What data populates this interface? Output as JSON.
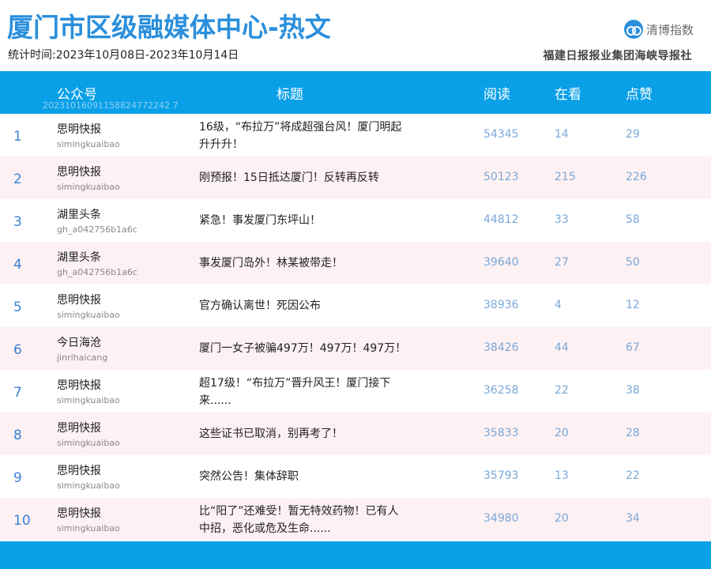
{
  "header": {
    "title": "厦门市区级融媒体中心-热文",
    "period": "统计时间:2023年10月08日-2023年10月14日",
    "brand_name": "清博指数",
    "publisher": "福建日报报业集团海峡导报社"
  },
  "table": {
    "columns": {
      "account": "公众号",
      "title": "标题",
      "reads": "阅读",
      "watching": "在看",
      "likes": "点赞"
    },
    "header_id": "20231016091158824772242 7",
    "rows": [
      {
        "rank": "1",
        "account": "思明快报",
        "account_id": "simingkuaibao",
        "title_line1": "16级，“布拉万”将成超强台风！厦门明起",
        "title_line2": "升升升！",
        "reads": "54345",
        "watching": "14",
        "likes": "29"
      },
      {
        "rank": "2",
        "account": "思明快报",
        "account_id": "simingkuaibao",
        "title_line1": "刚预报！15日抵达厦门！反转再反转",
        "title_line2": "",
        "reads": "50123",
        "watching": "215",
        "likes": "226"
      },
      {
        "rank": "3",
        "account": "湖里头条",
        "account_id": "gh_a042756b1a6c",
        "title_line1": "紧急！事发厦门东坪山！",
        "title_line2": "",
        "reads": "44812",
        "watching": "33",
        "likes": "58"
      },
      {
        "rank": "4",
        "account": "湖里头条",
        "account_id": "gh_a042756b1a6c",
        "title_line1": "事发厦门岛外！林某被带走！",
        "title_line2": "",
        "reads": "39640",
        "watching": "27",
        "likes": "50"
      },
      {
        "rank": "5",
        "account": "思明快报",
        "account_id": "simingkuaibao",
        "title_line1": "官方确认离世！死因公布",
        "title_line2": "",
        "reads": "38936",
        "watching": "4",
        "likes": "12"
      },
      {
        "rank": "6",
        "account": "今日海沧",
        "account_id": "jinrihaicang",
        "title_line1": "厦门一女子被骗497万！497万！497万！",
        "title_line2": "",
        "reads": "38426",
        "watching": "44",
        "likes": "67"
      },
      {
        "rank": "7",
        "account": "思明快报",
        "account_id": "simingkuaibao",
        "title_line1": "超17级！“布拉万”晋升风王！厦门接下",
        "title_line2": "来......",
        "reads": "36258",
        "watching": "22",
        "likes": "38"
      },
      {
        "rank": "8",
        "account": "思明快报",
        "account_id": "simingkuaibao",
        "title_line1": "这些证书已取消，别再考了！",
        "title_line2": "",
        "reads": "35833",
        "watching": "20",
        "likes": "28"
      },
      {
        "rank": "9",
        "account": "思明快报",
        "account_id": "simingkuaibao",
        "title_line1": "突然公告！集体辞职",
        "title_line2": "",
        "reads": "35793",
        "watching": "13",
        "likes": "22"
      },
      {
        "rank": "10",
        "account": "思明快报",
        "account_id": "simingkuaibao",
        "title_line1": "比“阳了”还难受！暂无特效药物！已有人",
        "title_line2": "中招，恶化或危及生命......",
        "reads": "34980",
        "watching": "20",
        "likes": "34"
      }
    ]
  },
  "colors": {
    "accent": "#0aa0e8",
    "title": "#2b8fdc",
    "row_alt": "#fdf1f3",
    "numbers": "#7aa8d8"
  }
}
